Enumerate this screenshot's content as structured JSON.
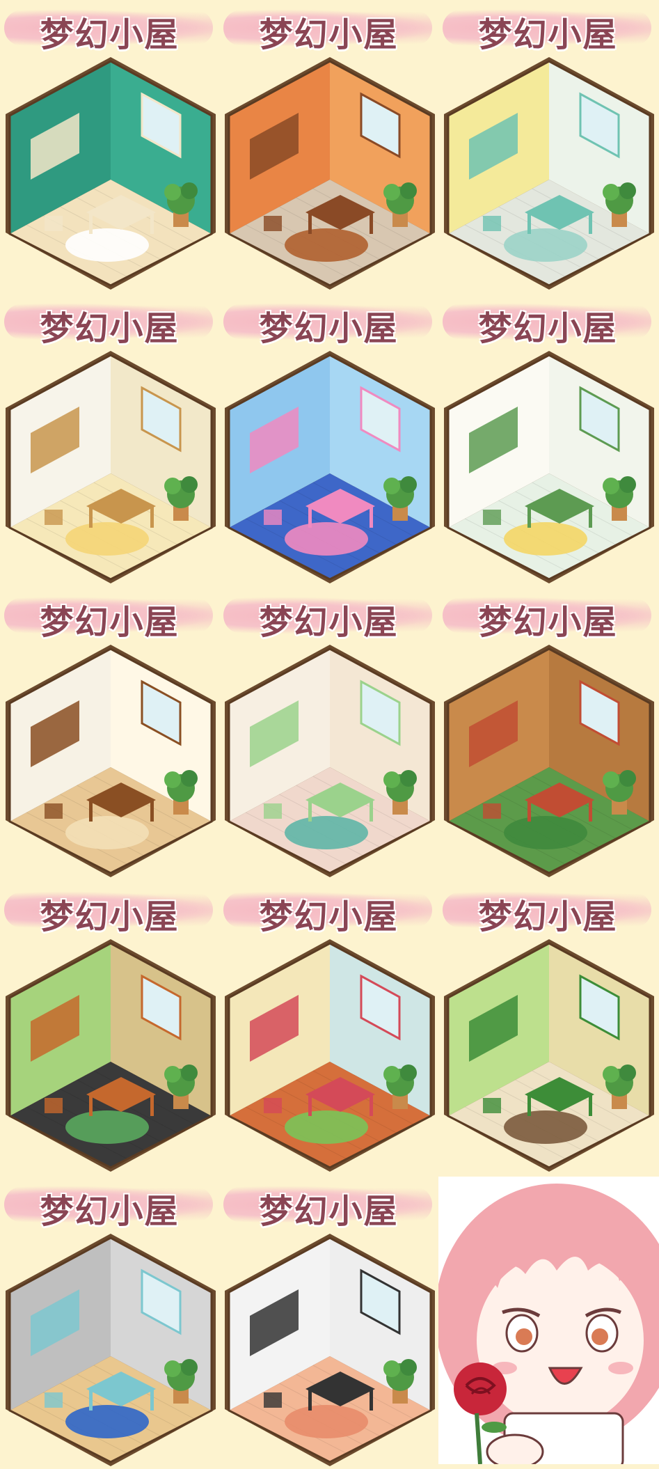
{
  "title_text": "梦幻小屋",
  "rooms": [
    {
      "name": "room-green-dressing",
      "wall": "#2f9a80",
      "wall2": "#3aad90",
      "floor": "#f3e2bd",
      "accent": "#f3e6c8",
      "rug": "#ffffff"
    },
    {
      "name": "room-orange-kitchen",
      "wall": "#e98545",
      "wall2": "#f1a15c",
      "floor": "#d8c7b1",
      "accent": "#8a4a26",
      "rug": "#b06030"
    },
    {
      "name": "room-yellow-shop",
      "wall": "#f4ea9a",
      "wall2": "#ecf3ea",
      "floor": "#e3e7de",
      "accent": "#6fc3b2",
      "rug": "#9bd3c8"
    },
    {
      "name": "room-white-study",
      "wall": "#f7f4ea",
      "wall2": "#f2e8c9",
      "floor": "#f6e8b9",
      "accent": "#c8954d",
      "rug": "#f5d577"
    },
    {
      "name": "room-blue-arcade",
      "wall": "#8fc7ee",
      "wall2": "#a7d7f3",
      "floor": "#3e67c8",
      "accent": "#f08ac0",
      "rug": "#f08ac0"
    },
    {
      "name": "room-white-boutique",
      "wall": "#fbfaf3",
      "wall2": "#f2f5ec",
      "floor": "#e7f1e5",
      "accent": "#5d9b52",
      "rug": "#f4d666"
    },
    {
      "name": "room-bakery",
      "wall": "#f7f2e5",
      "wall2": "#fff8e6",
      "floor": "#e8c794",
      "accent": "#8a4f23",
      "rug": "#f3dfb6"
    },
    {
      "name": "room-art-studio",
      "wall": "#f7efe2",
      "wall2": "#f4e7d4",
      "floor": "#f0d8cc",
      "accent": "#9bd28c",
      "rug": "#5fb6a7"
    },
    {
      "name": "room-tree-house",
      "wall": "#c98a4b",
      "wall2": "#b77a3f",
      "floor": "#5c9b4a",
      "accent": "#c14d33",
      "rug": "#3f8a3d"
    },
    {
      "name": "room-workshop",
      "wall": "#a6d37c",
      "wall2": "#d7c28a",
      "floor": "#3a3a3a",
      "accent": "#c5682d",
      "rug": "#5aa85e"
    },
    {
      "name": "room-cafe-bar",
      "wall": "#f4e7b9",
      "wall2": "#cfe6e5",
      "floor": "#d56f3b",
      "accent": "#d44a58",
      "rug": "#7bc359"
    },
    {
      "name": "room-greenhouse",
      "wall": "#bde08d",
      "wall2": "#e8dda9",
      "floor": "#efe2c5",
      "accent": "#3d8d38",
      "rug": "#7b5b3d"
    },
    {
      "name": "room-aquarium",
      "wall": "#bfbfbf",
      "wall2": "#d6d6d6",
      "floor": "#e9c78e",
      "accent": "#7cc7cf",
      "rug": "#2f66c9"
    },
    {
      "name": "room-music",
      "wall": "#f3f3f3",
      "wall2": "#eeeeee",
      "floor": "#f3b795",
      "accent": "#333333",
      "rug": "#e88c6a"
    }
  ],
  "portrait": {
    "hair": "#f2a7ae",
    "skin": "#fff1ea",
    "rose": "#c8263a",
    "eye": "#d97b55",
    "name": "chibi-girl-with-rose"
  }
}
